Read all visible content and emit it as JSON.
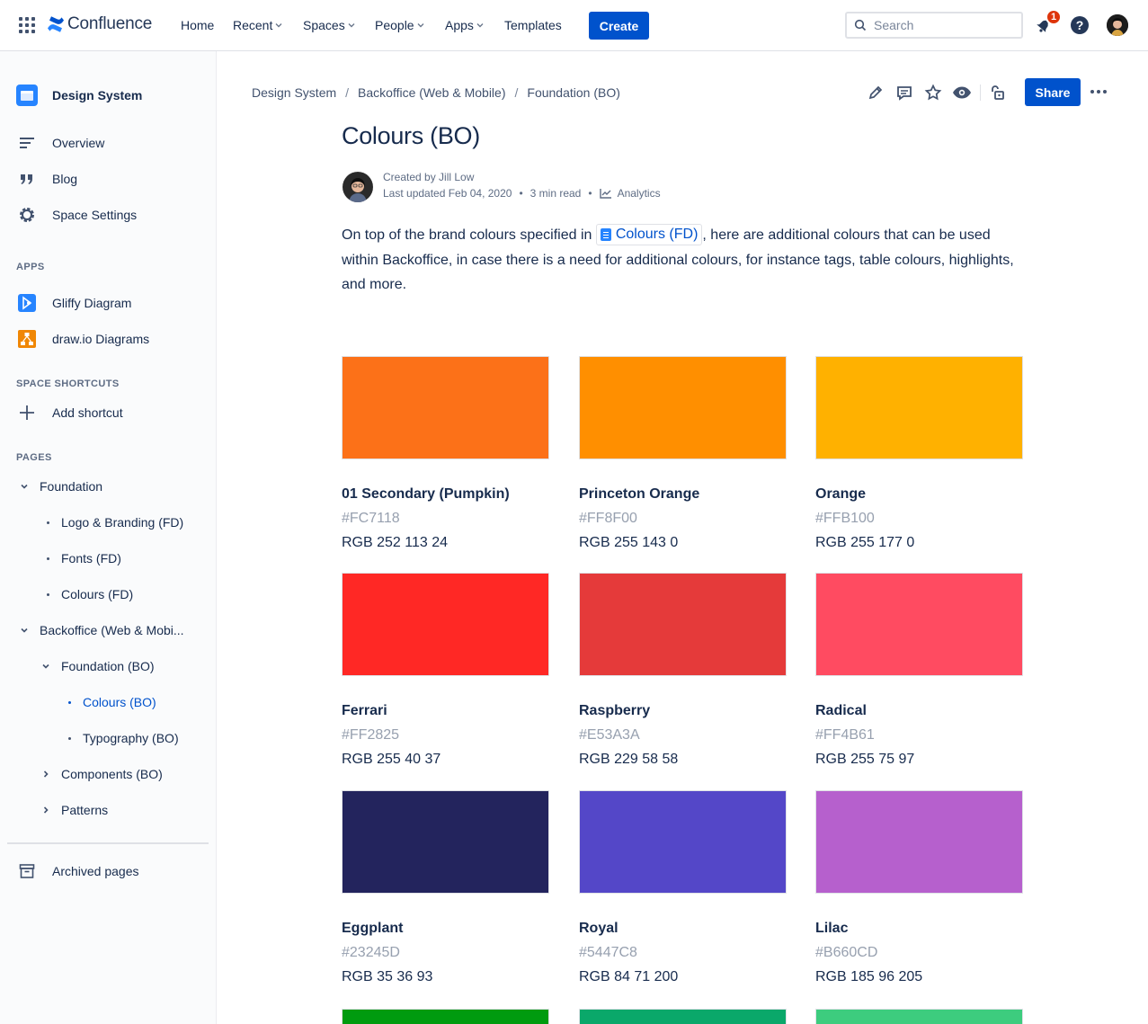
{
  "topnav": {
    "logo_text": "Confluence",
    "items": [
      "Home",
      "Recent",
      "Spaces",
      "People",
      "Apps",
      "Templates"
    ],
    "create_label": "Create",
    "search_placeholder": "Search",
    "notification_count": "1",
    "help_label": "?"
  },
  "sidebar": {
    "space_name": "Design System",
    "nav": [
      "Overview",
      "Blog",
      "Space Settings"
    ],
    "apps_heading": "APPS",
    "apps": [
      "Gliffy Diagram",
      "draw.io Diagrams"
    ],
    "shortcuts_heading": "SPACE SHORTCUTS",
    "add_shortcut": "Add shortcut",
    "pages_heading": "PAGES",
    "tree": [
      "Foundation",
      "Logo & Branding (FD)",
      "Fonts (FD)",
      "Colours (FD)",
      "Backoffice (Web & Mobi...",
      "Foundation (BO)",
      "Colours (BO)",
      "Typography (BO)",
      "Components (BO)",
      "Patterns"
    ],
    "archived": "Archived pages"
  },
  "page": {
    "breadcrumbs": [
      "Design System",
      "Backoffice (Web & Mobile)",
      "Foundation (BO)"
    ],
    "share_label": "Share",
    "title": "Colours (BO)",
    "created_by": "Created by Jill Low",
    "last_updated": "Last updated Feb 04, 2020",
    "read_time": "3 min read",
    "analytics": "Analytics",
    "intro_before": "On top of the brand colours specified in",
    "intro_link": "Colours (FD)",
    "intro_after": ", here are additional colours that can be used within Backoffice, in case there is a need for additional colours, for instance tags, table colours, highlights, and more."
  },
  "colours": [
    {
      "name": "01 Secondary (Pumpkin)",
      "hex": "#FC7118",
      "rgb": "RGB 252 113 24",
      "color": "#FC7118"
    },
    {
      "name": "Princeton Orange",
      "hex": "#FF8F00",
      "rgb": "RGB 255 143 0",
      "color": "#FF8F00"
    },
    {
      "name": "Orange",
      "hex": "#FFB100",
      "rgb": "RGB 255 177 0",
      "color": "#FFB100"
    },
    {
      "name": "Ferrari",
      "hex": "#FF2825",
      "rgb": "RGB 255 40 37",
      "color": "#FF2825"
    },
    {
      "name": "Raspberry",
      "hex": "#E53A3A",
      "rgb": "RGB 229 58 58",
      "color": "#E53A3A"
    },
    {
      "name": "Radical",
      "hex": "#FF4B61",
      "rgb": "RGB 255 75 97",
      "color": "#FF4B61"
    },
    {
      "name": "Eggplant",
      "hex": "#23245D",
      "rgb": "RGB 35 36 93",
      "color": "#23245D"
    },
    {
      "name": "Royal",
      "hex": "#5447C8",
      "rgb": "RGB 84 71 200",
      "color": "#5447C8"
    },
    {
      "name": "Lilac",
      "hex": "#B660CD",
      "rgb": "RGB 185 96 205",
      "color": "#B660CD"
    }
  ],
  "partial_swatch_colors": [
    "#009B0F",
    "#0AA86A",
    "#3DCC7E"
  ]
}
